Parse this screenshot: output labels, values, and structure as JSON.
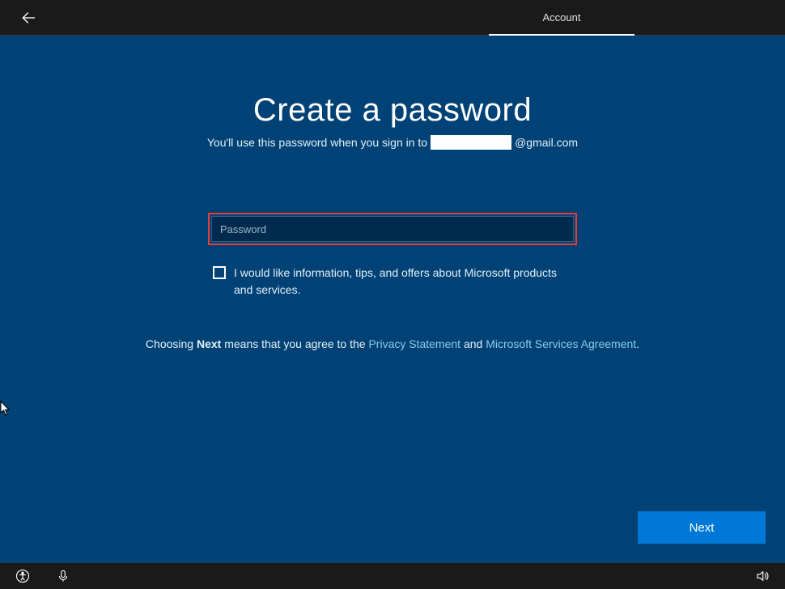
{
  "header": {
    "tab_label": "Account"
  },
  "main": {
    "heading": "Create a password",
    "subtitle_prefix": "You'll use this password when you sign in to",
    "email_domain": "@gmail.com",
    "password_placeholder": "Password",
    "password_value": "",
    "checkbox_label": "I would like information, tips, and offers about Microsoft products and services.",
    "agree_prefix": "Choosing ",
    "agree_bold": "Next",
    "agree_mid": " means that you agree to the ",
    "privacy_link": "Privacy Statement",
    "agree_and": " and ",
    "services_link": "Microsoft Services Agreement",
    "agree_suffix": ".",
    "next_label": "Next"
  },
  "icons": {
    "back": "back-arrow",
    "accessibility": "accessibility-icon",
    "microphone": "microphone-icon",
    "volume": "volume-icon"
  },
  "colors": {
    "background_dark": "#1a1a1a",
    "panel_blue": "#004275",
    "accent_blue": "#0078d7",
    "highlight_red": "#eb3a35",
    "link_blue": "#8fc8ea"
  }
}
